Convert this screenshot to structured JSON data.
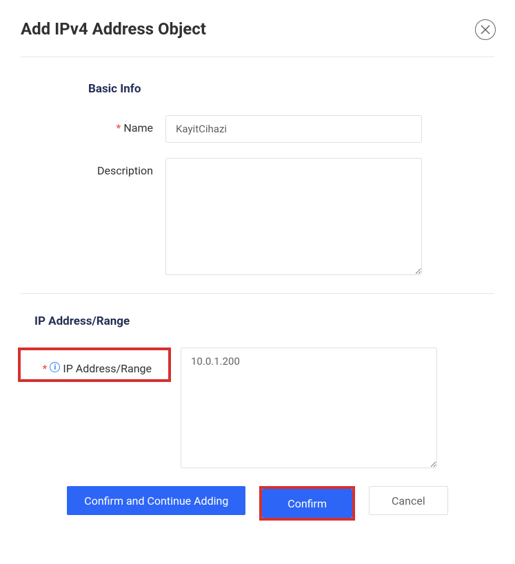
{
  "dialog": {
    "title": "Add IPv4 Address Object"
  },
  "sections": {
    "basic": {
      "title": "Basic Info"
    },
    "iprange": {
      "title": "IP Address/Range"
    }
  },
  "fields": {
    "name": {
      "label": "Name",
      "value": "KayitCihazi"
    },
    "description": {
      "label": "Description",
      "value": ""
    },
    "ip": {
      "label": "IP Address/Range",
      "value": "10.0.1.200"
    }
  },
  "buttons": {
    "confirm_continue": "Confirm and Continue Adding",
    "confirm": "Confirm",
    "cancel": "Cancel"
  }
}
